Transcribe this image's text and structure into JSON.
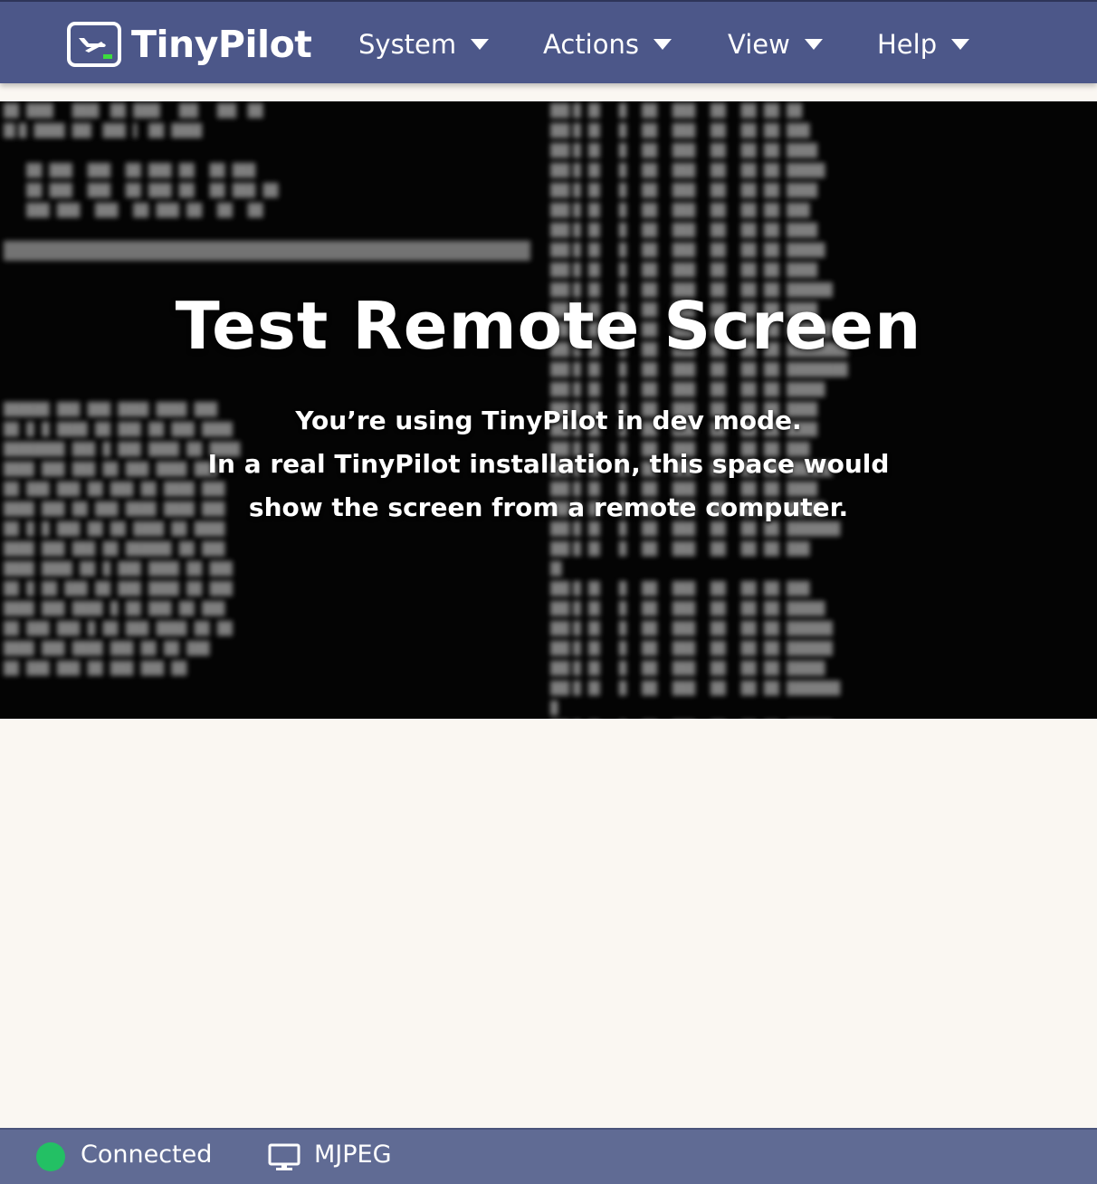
{
  "navbar": {
    "brand": "TinyPilot",
    "menus": [
      {
        "label": "System"
      },
      {
        "label": "Actions"
      },
      {
        "label": "View"
      },
      {
        "label": "Help"
      }
    ]
  },
  "remote_screen": {
    "title": "Test Remote Screen",
    "message_lines": [
      "You’re using TinyPilot in dev mode.",
      "In a real TinyPilot installation, this space would",
      "show the screen from a remote computer."
    ]
  },
  "statusbar": {
    "connection_status": "Connected",
    "stream_mode": "MJPEG",
    "connected_color": "#23c064",
    "stream_icon": "monitor-icon"
  },
  "colors": {
    "navbar": "#4c5789",
    "statusbar": "#606b94",
    "page_bg": "#faf7f2",
    "brand_accent": "#3ddc3d"
  }
}
